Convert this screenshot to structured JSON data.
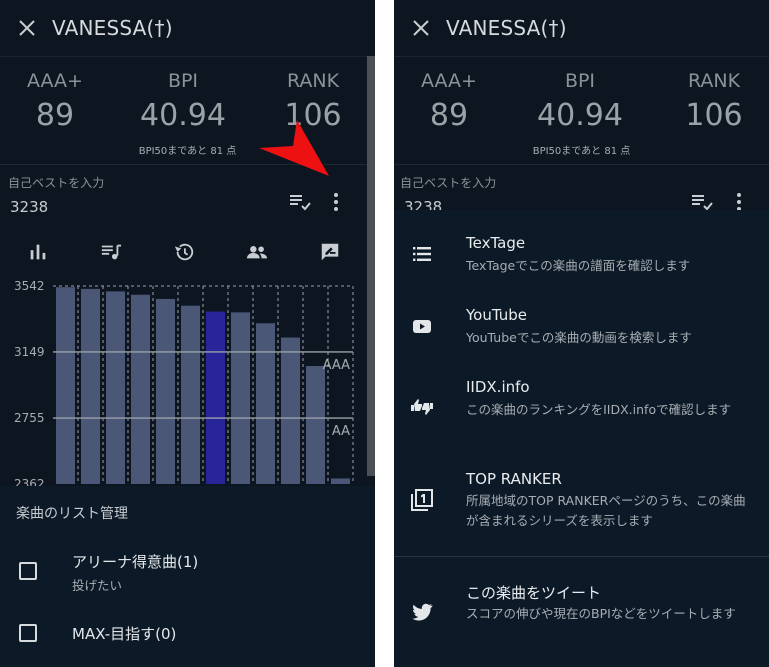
{
  "header": {
    "title": "VANESSA(†)"
  },
  "stats": {
    "aaa_label": "AAA+",
    "aaa_value": "89",
    "bpi_label": "BPI",
    "bpi_value": "40.94",
    "rank_label": "RANK",
    "rank_value": "106",
    "bpi_note": "BPI50まであと 81 点"
  },
  "self_best": {
    "label": "自己ベストを入力",
    "value": "3238"
  },
  "icons": {
    "close": "close-icon",
    "playlist": "playlist-check-icon",
    "more": "more-vert-icon",
    "tabs": [
      "bar-chart-icon",
      "queue-music-icon",
      "history-icon",
      "people-icon",
      "rate-review-icon"
    ]
  },
  "chart_data": {
    "type": "bar",
    "y_ticks": [
      "3542",
      "3149",
      "2755",
      "2362"
    ],
    "ylim": [
      2362,
      3542
    ],
    "values": [
      3535,
      3525,
      3510,
      3490,
      3465,
      3425,
      3390,
      3385,
      3320,
      3235,
      3065,
      2395
    ],
    "highlight_index": 6,
    "reference_lines": [
      {
        "label": "AAA",
        "value": 3149
      },
      {
        "label": "AA",
        "value": 2755
      }
    ],
    "colors": {
      "bar": "#4a5777",
      "highlight": "#28259a",
      "grid": "#9aa1a7"
    }
  },
  "list_sheet": {
    "heading": "楽曲のリスト管理",
    "items": [
      {
        "title": "アリーナ得意曲(1)",
        "subtitle": "投げたい"
      },
      {
        "title": "MAX-目指す(0)",
        "subtitle": ""
      }
    ]
  },
  "menu": [
    {
      "icon": "list-icon",
      "title": "TexTage",
      "subtitle": "TexTageでこの楽曲の譜面を確認します"
    },
    {
      "icon": "youtube-icon",
      "title": "YouTube",
      "subtitle": "YouTubeでこの楽曲の動画を検索します"
    },
    {
      "icon": "thumbs-up-down-icon",
      "title": "IIDX.info",
      "subtitle": "この楽曲のランキングをIIDX.infoで確認します"
    },
    {
      "icon": "filter-1-icon",
      "title": "TOP RANKER",
      "subtitle": "所属地域のTOP RANKERページのうち、この楽曲が含まれるシリーズを表示します"
    },
    {
      "icon": "twitter-icon",
      "title": "この楽曲をツイート",
      "subtitle": "スコアの伸びや現在のBPIなどをツイートします"
    }
  ],
  "colors": {
    "background": "#0d1520",
    "sheet": "#0c1a28",
    "annotation_arrow": "#ee1111"
  }
}
